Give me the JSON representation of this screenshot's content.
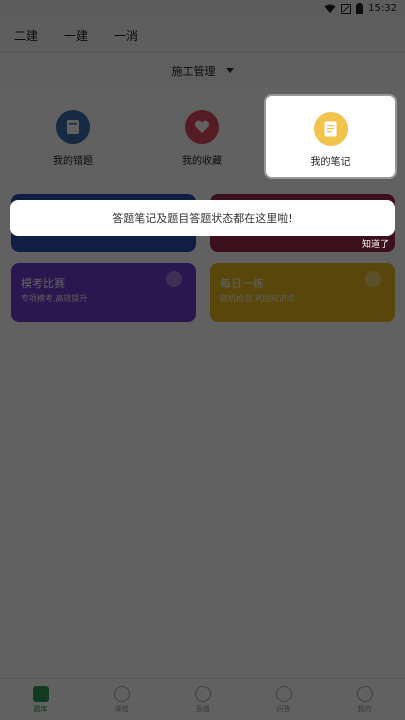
{
  "statusbar": {
    "time": "15:32"
  },
  "topnav": {
    "items": [
      "二建",
      "一建",
      "一消"
    ]
  },
  "subheader": {
    "title": "施工管理"
  },
  "quick": {
    "items": [
      {
        "label": "我的错题",
        "color": "#3b6fb0"
      },
      {
        "label": "我的收藏",
        "color": "#e04a5c"
      },
      {
        "label": "我的笔记",
        "color": "#f2c44d"
      }
    ]
  },
  "cards": [
    {
      "title": "",
      "sub": "",
      "color": "#2f4fb3"
    },
    {
      "title": "",
      "sub": "",
      "color": "#9c2a4a"
    },
    {
      "title": "模考比赛",
      "sub": "专项模考,高效提升",
      "color": "#6a3fd0"
    },
    {
      "title": "每日一练",
      "sub": "随机检测,巩固知识点",
      "color": "#e7b81f"
    }
  ],
  "tabbar": {
    "items": [
      "题库",
      "课程",
      "直播",
      "问答",
      "我的"
    ]
  },
  "guide": {
    "tip": "答题笔记及题目答题状态都在这里啦!",
    "got_it": "知道了"
  }
}
